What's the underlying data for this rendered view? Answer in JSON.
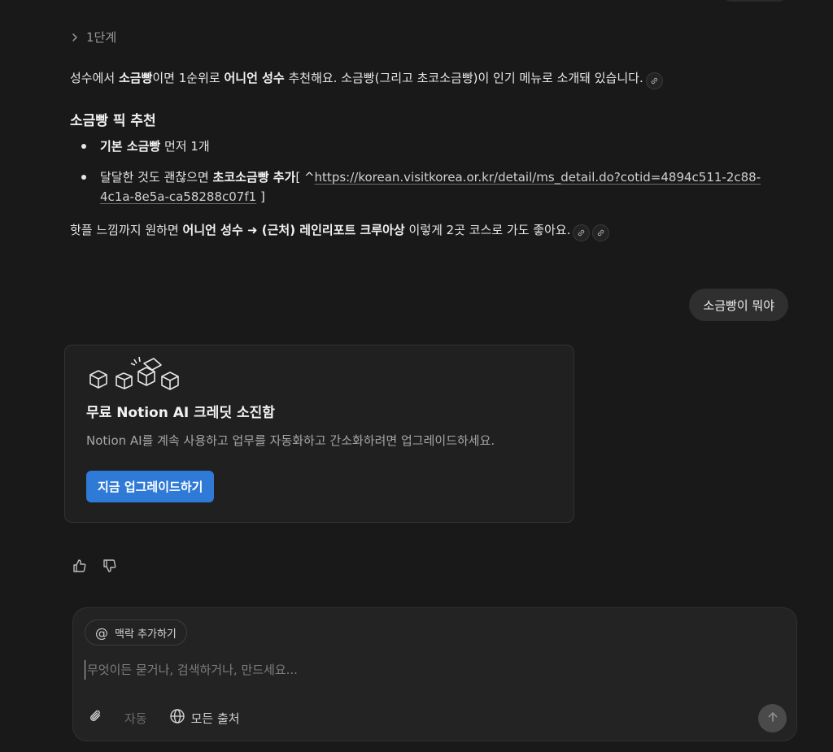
{
  "answer": {
    "step_label": "1단계",
    "p1": {
      "t1": "성수에서 ",
      "b1": "소금빵",
      "t2": "이면 1순위로 ",
      "b2": "어니언 성수",
      "t3": " 추천해요. 소금빵(그리고 초코소금빵)이 인기 메뉴로 소개돼 있습니다."
    },
    "heading": "소금빵 픽 추천",
    "bullet1": {
      "b": "기본 소금빵",
      "t": " 먼저 1개"
    },
    "bullet2": {
      "t1": "달달한 것도 괜찮으면 ",
      "b": "초코소금빵 추가",
      "t2": "[ ^",
      "link": "https://korean.visitkorea.or.kr/detail/ms_detail.do?cotid=4894c511-2c88-4c1a-8e5a-ca58288c07f1",
      "t3": " ]"
    },
    "p2": {
      "t1": "핫플 느낌까지 원하면 ",
      "b1": "어니언 성수 ➜ (근처) 레인리포트 크루아상",
      "t2": " 이렇게 2곳 코스로 가도 좋아요."
    }
  },
  "user_message": "소금빵이 뭐야",
  "upgrade_card": {
    "title": "무료 Notion AI 크레딧 소진함",
    "description": "Notion AI를 계속 사용하고 업무를 자동화하고 간소화하려면 업그레이드하세요.",
    "button": "지금 업그레이드하기"
  },
  "feedback": {
    "like_icon": "thumbs-up-icon",
    "dislike_icon": "thumbs-down-icon"
  },
  "composer": {
    "context_chip": "맥락 추가하기",
    "placeholder": "무엇이든 묻거나, 검색하거나, 만드세요...",
    "mode": "자동",
    "sources": "모든 출처"
  },
  "colors": {
    "background": "#191919",
    "accent": "#2e7ad6",
    "card": "#202020"
  }
}
